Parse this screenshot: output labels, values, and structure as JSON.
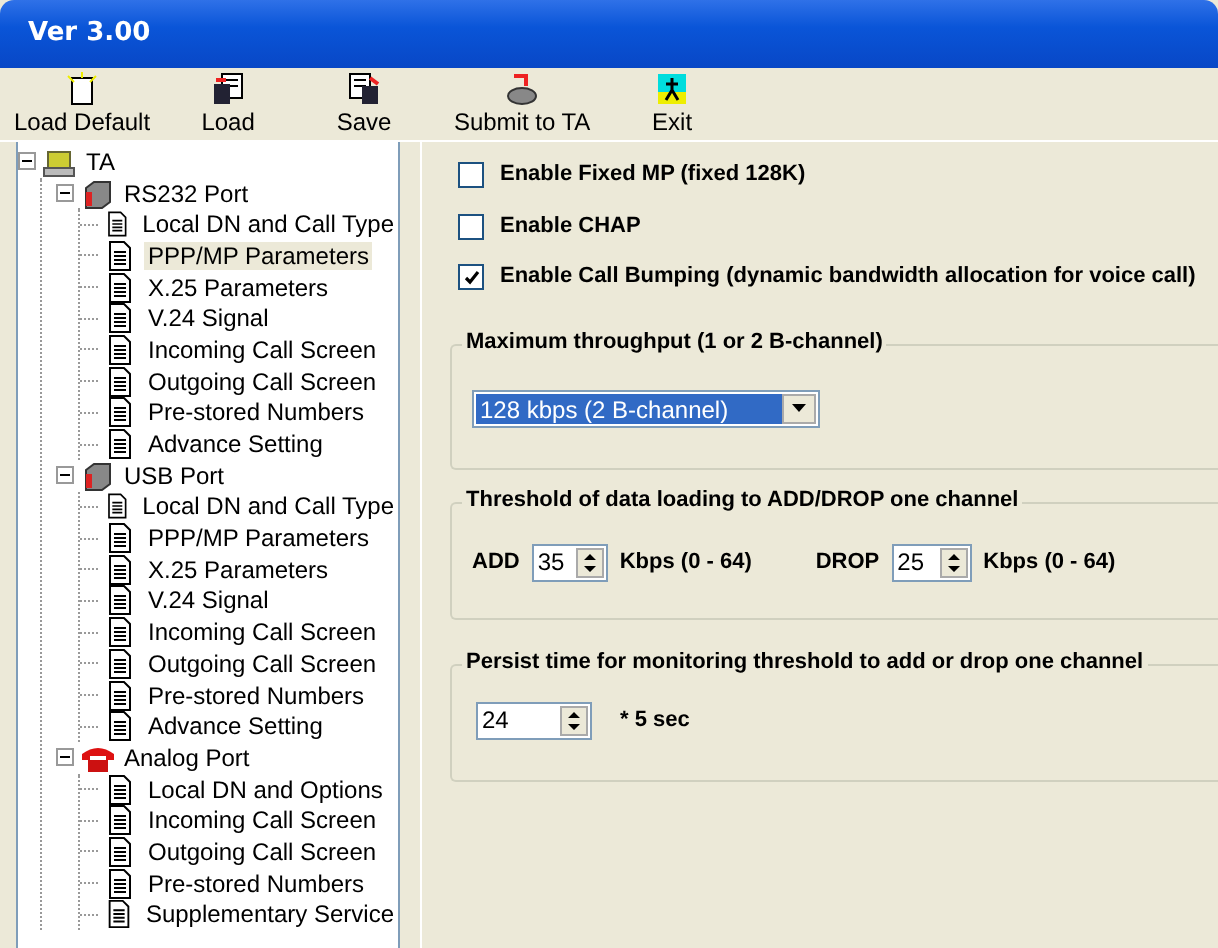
{
  "window": {
    "title": "Ver 3.00"
  },
  "toolbar": [
    {
      "label": "Load Default",
      "kind": "new"
    },
    {
      "label": "Load",
      "kind": "load"
    },
    {
      "label": "Save",
      "kind": "save"
    },
    {
      "label": "Submit to TA",
      "kind": "submit"
    },
    {
      "label": "Exit",
      "kind": "exit"
    }
  ],
  "tree": [
    {
      "label": "TA",
      "kind": "device",
      "expanded": true,
      "selected": false,
      "children": [
        {
          "label": "RS232 Port",
          "kind": "port",
          "expanded": true,
          "selected": false,
          "children": [
            {
              "label": "Local DN and Call Type",
              "kind": "page",
              "selected": false
            },
            {
              "label": "PPP/MP Parameters",
              "kind": "page",
              "selected": true
            },
            {
              "label": "X.25 Parameters",
              "kind": "page",
              "selected": false
            },
            {
              "label": "V.24 Signal",
              "kind": "page",
              "selected": false
            },
            {
              "label": "Incoming Call Screen",
              "kind": "page",
              "selected": false
            },
            {
              "label": "Outgoing Call Screen",
              "kind": "page",
              "selected": false
            },
            {
              "label": "Pre-stored Numbers",
              "kind": "page",
              "selected": false
            },
            {
              "label": "Advance Setting",
              "kind": "page",
              "selected": false
            }
          ]
        },
        {
          "label": "USB Port",
          "kind": "port",
          "expanded": true,
          "selected": false,
          "children": [
            {
              "label": "Local DN and Call Type",
              "kind": "page",
              "selected": false
            },
            {
              "label": "PPP/MP Parameters",
              "kind": "page",
              "selected": false
            },
            {
              "label": "X.25 Parameters",
              "kind": "page",
              "selected": false
            },
            {
              "label": "V.24 Signal",
              "kind": "page",
              "selected": false
            },
            {
              "label": "Incoming Call Screen",
              "kind": "page",
              "selected": false
            },
            {
              "label": "Outgoing Call Screen",
              "kind": "page",
              "selected": false
            },
            {
              "label": "Pre-stored Numbers",
              "kind": "page",
              "selected": false
            },
            {
              "label": "Advance Setting",
              "kind": "page",
              "selected": false
            }
          ]
        },
        {
          "label": "Analog Port",
          "kind": "phone",
          "expanded": true,
          "selected": false,
          "children": [
            {
              "label": "Local DN and Options",
              "kind": "page",
              "selected": false
            },
            {
              "label": "Incoming Call Screen",
              "kind": "page",
              "selected": false
            },
            {
              "label": "Outgoing Call Screen",
              "kind": "page",
              "selected": false
            },
            {
              "label": "Pre-stored Numbers",
              "kind": "page",
              "selected": false
            },
            {
              "label": "Supplementary Service",
              "kind": "page",
              "selected": false
            }
          ]
        }
      ]
    }
  ],
  "options": [
    {
      "label": "Enable Fixed MP (fixed 128K)",
      "checked": false
    },
    {
      "label": "Enable CHAP",
      "checked": false
    },
    {
      "label": "Enable Call Bumping (dynamic bandwidth allocation for voice call)",
      "checked": true
    }
  ],
  "throughput": {
    "title": "Maximum throughput (1 or 2 B-channel)",
    "value": "128 kbps (2 B-channel)"
  },
  "threshold": {
    "title": "Threshold of data loading to ADD/DROP one channel",
    "add": {
      "label": "ADD",
      "value": "35",
      "unit": "Kbps (0 - 64)"
    },
    "drop": {
      "label": "DROP",
      "value": "25",
      "unit": "Kbps (0 - 64)"
    }
  },
  "persist": {
    "title": "Persist time for monitoring threshold to add or drop one channel",
    "value": "24",
    "unit": "* 5 sec"
  }
}
